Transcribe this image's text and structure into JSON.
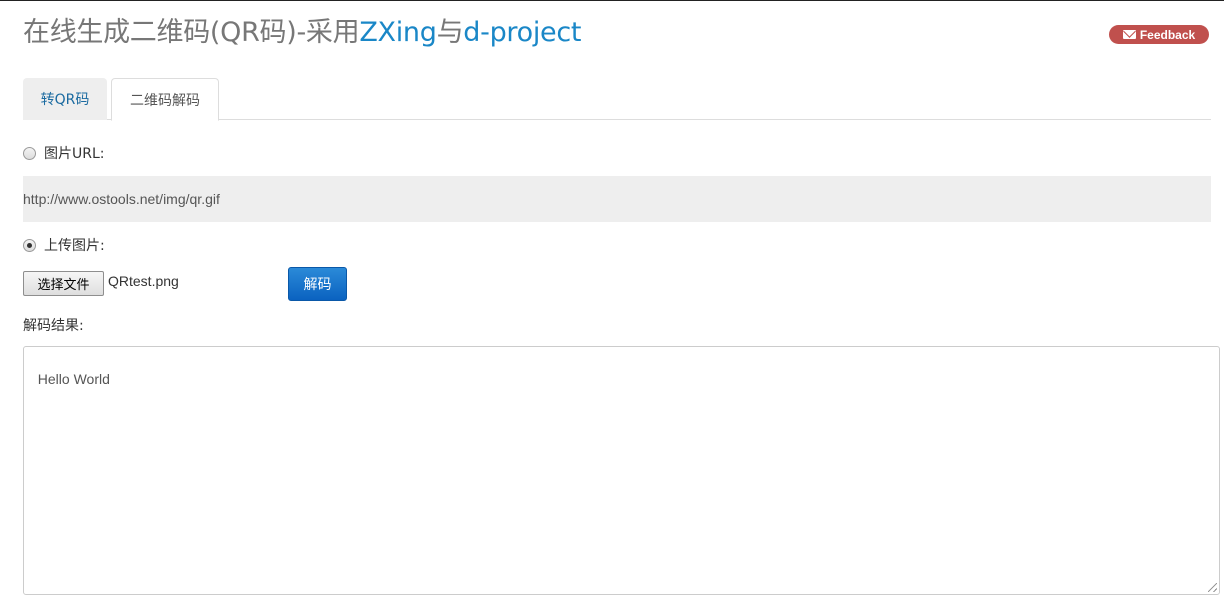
{
  "header": {
    "title_prefix": "在线生成二维码(QR码)-采用",
    "title_link1": "ZXing",
    "title_mid": "与",
    "title_link2": "d-project",
    "feedback_label": "Feedback",
    "feedback_icon": "envelope-icon"
  },
  "tabs": [
    {
      "label": "转QR码",
      "active": false
    },
    {
      "label": "二维码解码",
      "active": true
    }
  ],
  "url_option": {
    "label": "图片URL:",
    "checked": false,
    "value": "http://www.ostools.net/img/qr.gif"
  },
  "upload_option": {
    "label": "上传图片:",
    "checked": true,
    "choose_file_label": "选择文件",
    "file_name": "QRtest.png"
  },
  "decode_button_label": "解码",
  "result": {
    "label": "解码结果:",
    "value": "Hello World"
  },
  "colors": {
    "link": "#1a87c7",
    "feedback": "#c0504d",
    "primary_button": "#0b62c0"
  }
}
